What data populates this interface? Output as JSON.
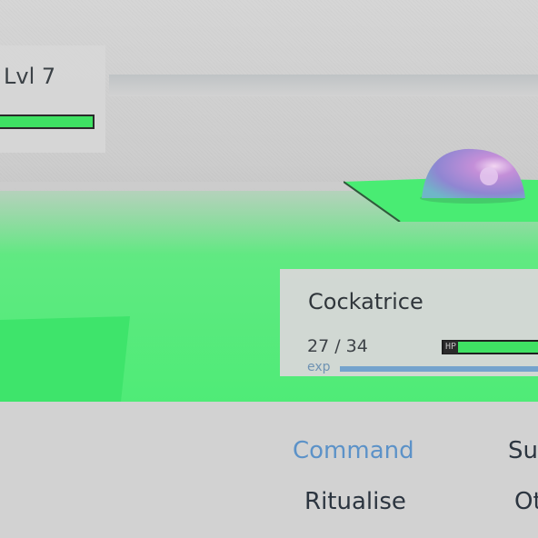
{
  "enemy": {
    "level_label": "Lvl 7",
    "hp_fraction": 1.0
  },
  "player": {
    "name": "Cockatrice",
    "hp_text": "27 / 34",
    "hp_label": "HP",
    "hp_fraction": 0.79,
    "exp_label": "exp",
    "exp_fraction": 1.0
  },
  "menu": {
    "items": [
      {
        "label": "Command",
        "selected": true
      },
      {
        "label": "Su",
        "selected": false
      },
      {
        "label": "Ritualise",
        "selected": false
      },
      {
        "label": "Ot",
        "selected": false
      }
    ]
  },
  "colors": {
    "hp_green": "#3fe163",
    "exp_blue": "#74a3cd",
    "menu_selected": "#5c92c8",
    "ground_green": "#4feb77",
    "creature": "#b48ad6"
  }
}
